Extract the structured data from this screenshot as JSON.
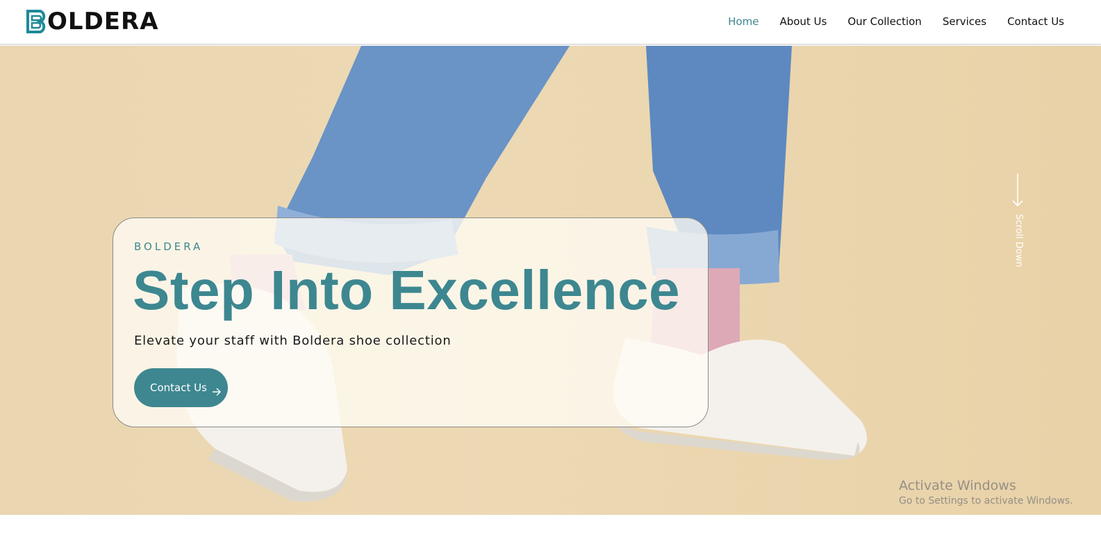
{
  "brand": {
    "name": "BOLDERA",
    "accent_color": "#3d8790"
  },
  "nav": {
    "items": [
      {
        "label": "Home",
        "active": true
      },
      {
        "label": "About Us",
        "active": false
      },
      {
        "label": "Our Collection",
        "active": false
      },
      {
        "label": "Services",
        "active": false
      },
      {
        "label": "Contact Us",
        "active": false
      }
    ]
  },
  "hero": {
    "eyebrow": "BOLDERA",
    "headline": "Step Into Excellence",
    "subline": "Elevate your staff with Boldera shoe collection",
    "cta_label": "Contact Us",
    "cta_icon": "arrow-right-icon",
    "scroll_label": "Scroll Down",
    "scroll_icon": "arrow-down-icon",
    "background_image": "jeans-and-white-sneakers-photo"
  },
  "watermark": {
    "title": "Activate Windows",
    "subtitle": "Go to Settings to activate Windows."
  }
}
